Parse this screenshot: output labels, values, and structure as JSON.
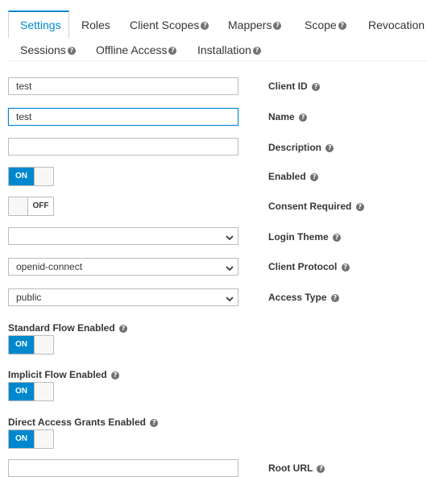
{
  "tabs": {
    "settings": "Settings",
    "roles": "Roles",
    "client_scopes": "Client Scopes",
    "mappers": "Mappers",
    "scope": "Scope",
    "revocation": "Revocation",
    "sessions": "Sessions",
    "offline_access": "Offline Access",
    "installation": "Installation"
  },
  "form": {
    "client_id": {
      "label": "Client ID",
      "value": "test"
    },
    "name": {
      "label": "Name",
      "value": "test"
    },
    "description": {
      "label": "Description",
      "value": ""
    },
    "enabled": {
      "label": "Enabled",
      "state": "ON"
    },
    "consent_required": {
      "label": "Consent Required",
      "state": "OFF"
    },
    "login_theme": {
      "label": "Login Theme",
      "value": ""
    },
    "client_protocol": {
      "label": "Client Protocol",
      "value": "openid-connect"
    },
    "access_type": {
      "label": "Access Type",
      "value": "public"
    },
    "standard_flow": {
      "label": "Standard Flow Enabled",
      "state": "ON"
    },
    "implicit_flow": {
      "label": "Implicit Flow Enabled",
      "state": "ON"
    },
    "direct_access": {
      "label": "Direct Access Grants Enabled",
      "state": "ON"
    },
    "root_url": {
      "label": "Root URL"
    }
  },
  "icons": {
    "help": "?",
    "chevron": "⌄"
  },
  "colors": {
    "accent": "#0088ce",
    "border": "#bbbbbb"
  }
}
